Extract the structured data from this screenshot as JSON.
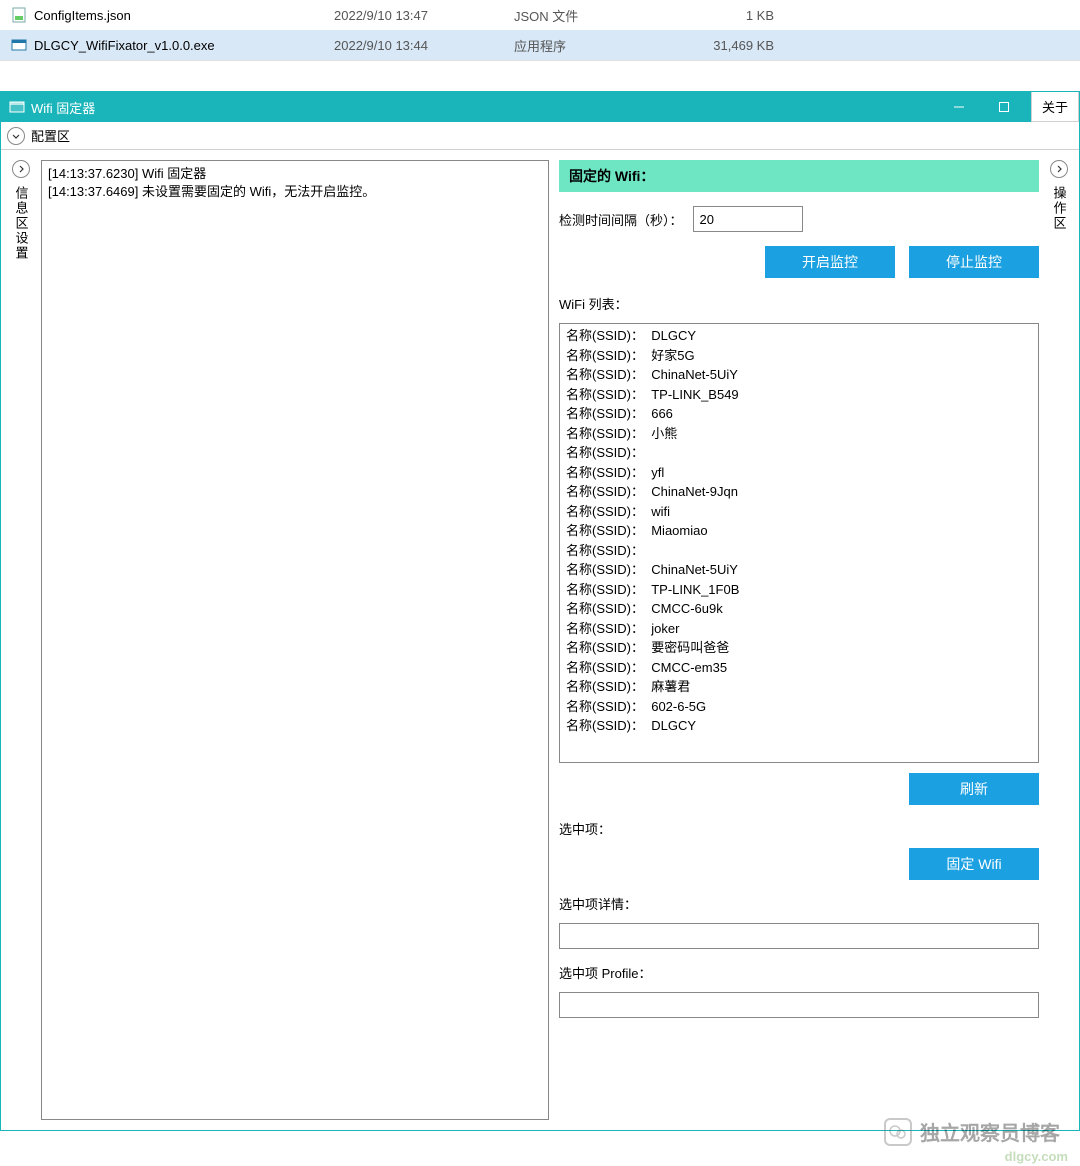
{
  "files": [
    {
      "icon": "json",
      "name": "ConfigItems.json",
      "date": "2022/9/10 13:47",
      "type": "JSON 文件",
      "size": "1 KB",
      "selected": false
    },
    {
      "icon": "exe",
      "name": "DLGCY_WifiFixator_v1.0.0.exe",
      "date": "2022/9/10 13:44",
      "type": "应用程序",
      "size": "31,469 KB",
      "selected": true
    }
  ],
  "window": {
    "title": "Wifi 固定器",
    "about": "关于"
  },
  "config_section_label": "配置区",
  "left_side_label": "信息区设置",
  "right_side_label": "操作区",
  "log_lines": [
    "[14:13:37.6230] Wifi 固定器",
    "[14:13:37.6469] 未设置需要固定的 Wifi，无法开启监控。"
  ],
  "right": {
    "fixed_wifi_label": "固定的 Wifi：",
    "interval_label": "检测时间间隔（秒）：",
    "interval_value": "20",
    "start_btn": "开启监控",
    "stop_btn": "停止监控",
    "wifi_list_label": "WiFi 列表：",
    "ssid_prefix": "名称(SSID)：",
    "wifi_items": [
      "DLGCY",
      "好家5G",
      "ChinaNet-5UiY",
      "TP-LINK_B549",
      "666",
      "小熊",
      "",
      "yfl",
      "ChinaNet-9Jqn",
      "wifi",
      "Miaomiao",
      "",
      "ChinaNet-5UiY",
      "TP-LINK_1F0B",
      "CMCC-6u9k",
      "joker",
      "要密码叫爸爸",
      "CMCC-em35",
      "麻薯君",
      "602-6-5G",
      "DLGCY"
    ],
    "refresh_btn": "刷新",
    "selected_label": "选中项：",
    "fix_wifi_btn": "固定 Wifi",
    "selected_detail_label": "选中项详情：",
    "selected_profile_label": "选中项 Profile："
  },
  "watermark": {
    "text": "独立观察员博客",
    "url": "dlgcy.com"
  }
}
